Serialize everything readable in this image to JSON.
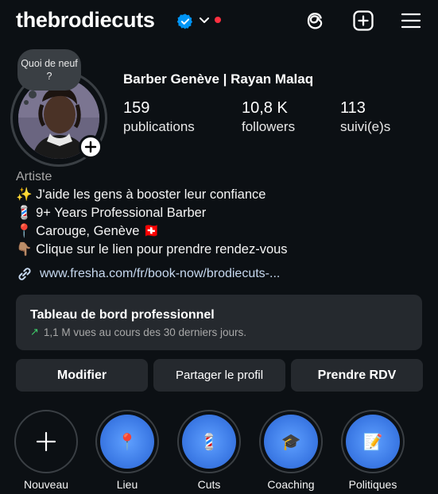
{
  "header": {
    "username": "thebrodiecuts",
    "accent_color": "#0095f6",
    "notification_color": "#ff3040",
    "icons": [
      "verified-icon",
      "chevron-down-icon",
      "threads-icon",
      "new-post-icon",
      "menu-icon"
    ]
  },
  "profile": {
    "note_bubble": "Quoi de neuf ?",
    "full_name": "Barber Genève | Rayan Malaq",
    "stats": [
      {
        "value": "159",
        "label": "publications"
      },
      {
        "value": "10,8 K",
        "label": "followers"
      },
      {
        "value": "113",
        "label": "suivi(e)s"
      }
    ],
    "category": "Artiste",
    "bio": [
      "✨ J'aide les gens à booster leur confiance",
      "💈 9+ Years Professional Barber",
      "📍 Carouge, Genève 🇨🇭",
      "👇🏽 Clique sur le lien pour prendre rendez-vous"
    ],
    "link": "www.fresha.com/fr/book-now/brodiecuts-..."
  },
  "dashboard": {
    "title": "Tableau de bord professionnel",
    "subtitle": "1,1 M vues au cours des 30 derniers jours."
  },
  "buttons": {
    "edit": "Modifier",
    "share": "Partager le profil",
    "book": "Prendre RDV"
  },
  "highlights": [
    {
      "label": "Nouveau",
      "icon": "plus-icon",
      "glyph": ""
    },
    {
      "label": "Lieu",
      "icon": "pin-icon",
      "glyph": "📍"
    },
    {
      "label": "Cuts",
      "icon": "barber-pole-icon",
      "glyph": "💈"
    },
    {
      "label": "Coaching",
      "icon": "graduation-cap-icon",
      "glyph": "🎓"
    },
    {
      "label": "Politiques",
      "icon": "memo-icon",
      "glyph": "📝"
    }
  ]
}
